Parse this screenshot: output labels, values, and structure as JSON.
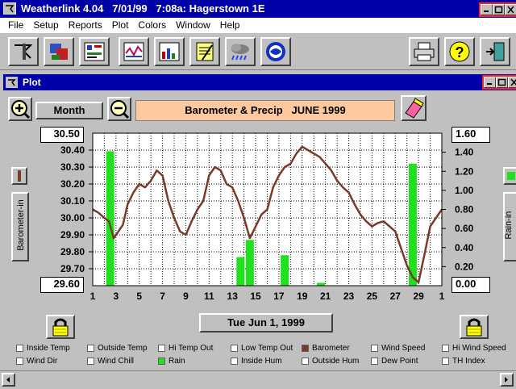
{
  "app": {
    "title": "Weatherlink 4.04   7/01/99   7:08a: Hagerstown 1E"
  },
  "menu": [
    "File",
    "Setup",
    "Reports",
    "Plot",
    "Colors",
    "Window",
    "Help"
  ],
  "plot_window": {
    "title": "Plot",
    "period_button": "Month",
    "chart_title": "Barometer & Precip   JUNE 1999",
    "date_button": "Tue Jun 1, 1999",
    "left_axis_label": "Barometer-in",
    "right_axis_label": "Rain-in"
  },
  "legend": [
    {
      "label": "Inside Temp",
      "checked": false,
      "color": "#ffffff"
    },
    {
      "label": "Outside Temp",
      "checked": false,
      "color": "#ffffff"
    },
    {
      "label": "Hi Temp Out",
      "checked": false,
      "color": "#ffffff"
    },
    {
      "label": "Low Temp Out",
      "checked": false,
      "color": "#ffffff"
    },
    {
      "label": "Barometer",
      "checked": true,
      "color": "#7a3a2a"
    },
    {
      "label": "Wind Speed",
      "checked": false,
      "color": "#ffffff"
    },
    {
      "label": "Hi Wind Speed",
      "checked": false,
      "color": "#ffffff"
    },
    {
      "label": "Wind Dir",
      "checked": false,
      "color": "#ffffff"
    },
    {
      "label": "Wind Chill",
      "checked": false,
      "color": "#ffffff"
    },
    {
      "label": "Rain",
      "checked": true,
      "color": "#20e020"
    },
    {
      "label": "Inside Hum",
      "checked": false,
      "color": "#ffffff"
    },
    {
      "label": "Outside Hum",
      "checked": false,
      "color": "#ffffff"
    },
    {
      "label": "Dew Point",
      "checked": false,
      "color": "#ffffff"
    },
    {
      "label": "TH Index",
      "checked": false,
      "color": "#ffffff"
    }
  ],
  "chart_data": {
    "type": "bar+line",
    "title": "Barometer & Precip   JUNE 1999",
    "xlabel": "",
    "x_ticks": [
      "1",
      "3",
      "5",
      "7",
      "9",
      "11",
      "13",
      "15",
      "17",
      "19",
      "21",
      "23",
      "25",
      "27",
      "29",
      "1"
    ],
    "xlim": [
      1,
      31
    ],
    "left_axis": {
      "label": "Barometer-in",
      "ticks": [
        "30.50",
        "30.40",
        "30.30",
        "30.20",
        "30.10",
        "30.00",
        "29.90",
        "29.80",
        "29.70",
        "29.60"
      ],
      "ylim": [
        29.6,
        30.5
      ]
    },
    "right_axis": {
      "label": "Rain-in",
      "ticks": [
        "1.60",
        "1.40",
        "1.20",
        "1.00",
        "0.80",
        "0.60",
        "0.40",
        "0.20",
        "0.00"
      ],
      "ylim": [
        0,
        1.6
      ]
    },
    "grid": true,
    "rain": {
      "name": "Rain",
      "color": "#20e020",
      "x": [
        2.5,
        13.7,
        14.5,
        17.5,
        20.6,
        28.5
      ],
      "values": [
        1.41,
        0.3,
        0.48,
        0.32,
        0.03,
        1.28
      ]
    },
    "barometer": {
      "name": "Barometer",
      "color": "#7a3a2a",
      "x": [
        1,
        1.5,
        2,
        2.4,
        2.8,
        3.2,
        3.6,
        4,
        4.5,
        5,
        5.5,
        6,
        6.5,
        7,
        7.5,
        8,
        8.5,
        9,
        9.5,
        10,
        10.5,
        11,
        11.5,
        12,
        12.5,
        13,
        13.5,
        14,
        14.5,
        15,
        15.5,
        16,
        16.5,
        17,
        17.5,
        18,
        18.5,
        19,
        19.5,
        20,
        20.5,
        21,
        21.5,
        22,
        22.5,
        23,
        23.5,
        24,
        24.5,
        25,
        25.5,
        26,
        26.5,
        27,
        27.5,
        28,
        28.5,
        29,
        29.5,
        30,
        30.5,
        31
      ],
      "values": [
        30.05,
        30.03,
        30.0,
        29.98,
        29.88,
        29.92,
        29.96,
        30.08,
        30.15,
        30.2,
        30.18,
        30.22,
        30.28,
        30.25,
        30.1,
        30.0,
        29.92,
        29.9,
        29.98,
        30.05,
        30.1,
        30.25,
        30.3,
        30.28,
        30.2,
        30.18,
        30.1,
        30.0,
        29.88,
        29.95,
        30.02,
        30.05,
        30.18,
        30.25,
        30.3,
        30.32,
        30.38,
        30.42,
        30.4,
        30.38,
        30.36,
        30.32,
        30.28,
        30.22,
        30.18,
        30.15,
        30.08,
        30.02,
        29.98,
        29.95,
        29.97,
        29.98,
        29.95,
        29.92,
        29.82,
        29.72,
        29.65,
        29.62,
        29.78,
        29.95,
        30.0,
        30.05
      ]
    }
  }
}
